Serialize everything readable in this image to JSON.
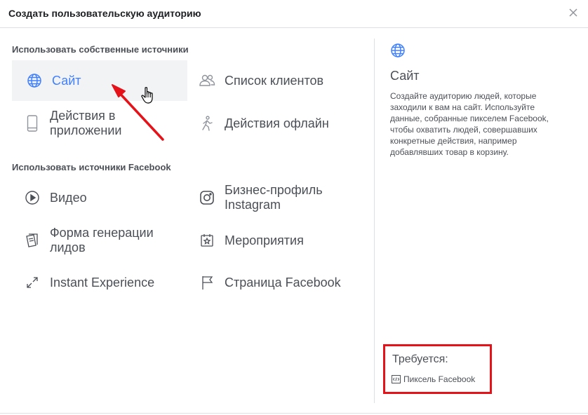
{
  "dialog": {
    "title": "Создать пользовательскую аудиторию"
  },
  "sections": {
    "own_sources": "Использовать собственные источники",
    "facebook_sources": "Использовать источники Facebook"
  },
  "options": {
    "website": "Сайт",
    "customer_list": "Список клиентов",
    "app_activity": "Действия в приложении",
    "offline_activity": "Действия офлайн",
    "video": "Видео",
    "instagram_profile": "Бизнес-профиль Instagram",
    "lead_form": "Форма генерации лидов",
    "events": "Мероприятия",
    "instant_experience": "Instant Experience",
    "facebook_page": "Страница Facebook"
  },
  "details": {
    "title": "Сайт",
    "description": "Создайте аудиторию людей, которые заходили к вам на сайт. Используйте данные, собранные пикселем Facebook, чтобы охватить людей, совершавших конкретные действия, например добавлявших товар в корзину."
  },
  "requirements": {
    "title": "Требуется:",
    "pixel_link": "Пиксель Facebook"
  },
  "icons": {
    "close": "close-icon",
    "website": "globe-icon",
    "customer_list": "people-icon",
    "app_activity": "mobile-phone-icon",
    "offline_activity": "walking-person-icon",
    "video": "play-circle-icon",
    "instagram_profile": "instagram-icon",
    "lead_form": "form-icon",
    "events": "calendar-star-icon",
    "instant_experience": "expand-arrows-icon",
    "facebook_page": "flag-icon",
    "pixel": "code-icon"
  },
  "colors": {
    "accent": "#4080ff",
    "text": "#4b4f56",
    "annotation": "#e5121a",
    "selected_bg": "#f2f3f5"
  }
}
